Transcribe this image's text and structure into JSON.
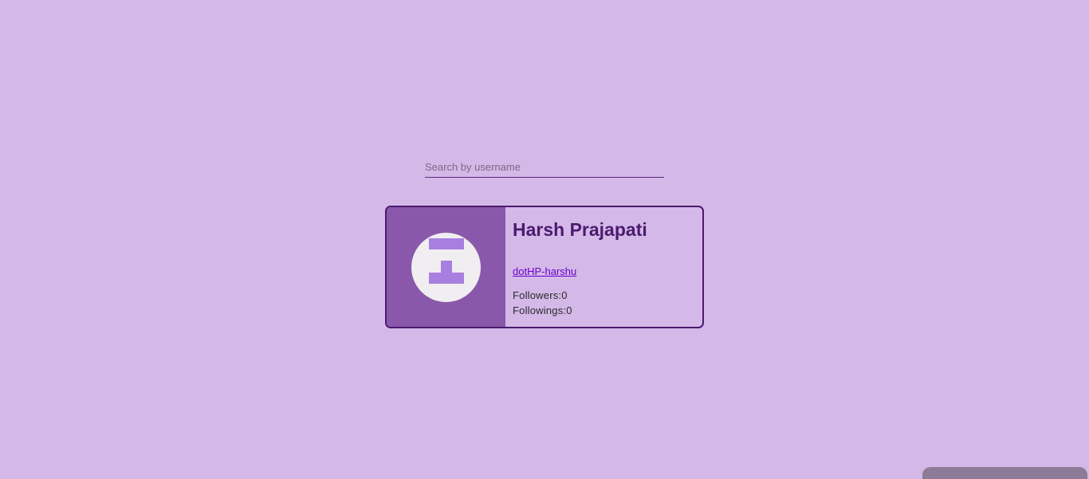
{
  "search": {
    "placeholder": "Search by username",
    "value": ""
  },
  "profile": {
    "name": "Harsh Prajapati",
    "username": "dotHP-harshu",
    "followers_label": "Followers:",
    "followers_count": "0",
    "followings_label": "Followings:",
    "followings_count": "0",
    "avatar_icon": "identicon"
  },
  "colors": {
    "background": "#d4b8e8",
    "card_border": "#4b1a6e",
    "avatar_panel": "#8a58aa",
    "identicon": "#a87fe0",
    "link": "#6a00cc"
  }
}
